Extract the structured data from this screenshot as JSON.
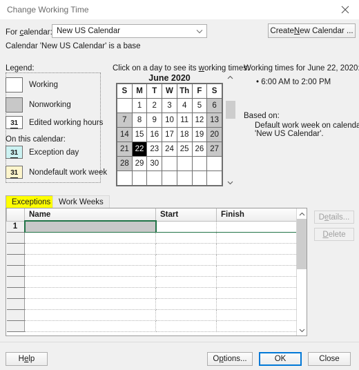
{
  "window": {
    "title": "Change Working Time",
    "close_icon": "close-icon"
  },
  "calendar_select": {
    "label": "For ",
    "label_accel": "c",
    "label_rest": "alendar:",
    "value": "New US Calendar",
    "arrow_icon": "chevron-down-icon",
    "create_label_pre": "Create ",
    "create_accel": "N",
    "create_label_post": "ew Calendar ...",
    "base_note": "Calendar 'New US Calendar' is a base"
  },
  "legend": {
    "label": "Legend:",
    "items": [
      {
        "name": "working",
        "text": "Working",
        "swatch": "plain",
        "color": "#ffffff",
        "glyph": ""
      },
      {
        "name": "nonworking",
        "text": "Nonworking",
        "swatch": "plain",
        "color": "#c8c8c8",
        "glyph": ""
      },
      {
        "name": "edited-working-hours",
        "text": "Edited working hours",
        "swatch": "day",
        "color": "#ffffff",
        "glyph": "31"
      }
    ],
    "subheading": "On this calendar:",
    "items2": [
      {
        "name": "exception-day",
        "text": "Exception day",
        "swatch": "day",
        "color": "#ccf2f2",
        "glyph": "31"
      },
      {
        "name": "nondefault-work-week",
        "text": "Nondefault work week",
        "swatch": "day",
        "color": "#fdf5cc",
        "glyph": "31"
      }
    ]
  },
  "calendar": {
    "hint_pre": "Click on a day to see its ",
    "hint_accel": "w",
    "hint_post": "orking times:",
    "month_title": "June 2020",
    "weekday_headers": [
      "S",
      "M",
      "T",
      "W",
      "Th",
      "F",
      "S"
    ],
    "weeks": [
      [
        {
          "d": "",
          "t": "empty"
        },
        {
          "d": "1",
          "t": "work"
        },
        {
          "d": "2",
          "t": "work"
        },
        {
          "d": "3",
          "t": "work"
        },
        {
          "d": "4",
          "t": "work"
        },
        {
          "d": "5",
          "t": "work"
        },
        {
          "d": "6",
          "t": "weekend"
        }
      ],
      [
        {
          "d": "7",
          "t": "weekend"
        },
        {
          "d": "8",
          "t": "work"
        },
        {
          "d": "9",
          "t": "work"
        },
        {
          "d": "10",
          "t": "work"
        },
        {
          "d": "11",
          "t": "work"
        },
        {
          "d": "12",
          "t": "work"
        },
        {
          "d": "13",
          "t": "weekend"
        }
      ],
      [
        {
          "d": "14",
          "t": "weekend"
        },
        {
          "d": "15",
          "t": "work"
        },
        {
          "d": "16",
          "t": "work"
        },
        {
          "d": "17",
          "t": "work"
        },
        {
          "d": "18",
          "t": "work"
        },
        {
          "d": "19",
          "t": "work"
        },
        {
          "d": "20",
          "t": "weekend"
        }
      ],
      [
        {
          "d": "21",
          "t": "weekend"
        },
        {
          "d": "22",
          "t": "selected"
        },
        {
          "d": "23",
          "t": "work"
        },
        {
          "d": "24",
          "t": "work"
        },
        {
          "d": "25",
          "t": "work"
        },
        {
          "d": "26",
          "t": "work"
        },
        {
          "d": "27",
          "t": "weekend"
        }
      ],
      [
        {
          "d": "28",
          "t": "weekend"
        },
        {
          "d": "29",
          "t": "work"
        },
        {
          "d": "30",
          "t": "work"
        },
        {
          "d": "",
          "t": "empty"
        },
        {
          "d": "",
          "t": "empty"
        },
        {
          "d": "",
          "t": "empty"
        },
        {
          "d": "",
          "t": "empty"
        }
      ],
      [
        {
          "d": "",
          "t": "empty"
        },
        {
          "d": "",
          "t": "empty"
        },
        {
          "d": "",
          "t": "empty"
        },
        {
          "d": "",
          "t": "empty"
        },
        {
          "d": "",
          "t": "empty"
        },
        {
          "d": "",
          "t": "empty"
        },
        {
          "d": "",
          "t": "empty"
        }
      ]
    ],
    "selected_day": "22",
    "scroll_up_icon": "chevron-up-icon",
    "scroll_down_icon": "chevron-down-icon"
  },
  "working_times": {
    "title": "Working times for June 22, 2020:",
    "entry": "• 6:00 AM to 2:00 PM",
    "based_on_label": "Based on:",
    "based_on_line1": "Default work week on calendar",
    "based_on_line2": "'New US Calendar'."
  },
  "tabs": [
    {
      "name": "exceptions",
      "label": "Exceptions",
      "active": true
    },
    {
      "name": "work-weeks",
      "label": "Work Weeks",
      "active": false
    }
  ],
  "exceptions_table": {
    "columns": [
      "",
      "Name",
      "Start",
      "Finish"
    ],
    "rows": [
      {
        "index": "1",
        "name": "",
        "start": "",
        "finish": "",
        "selected": true
      },
      {
        "index": "",
        "name": "",
        "start": "",
        "finish": "",
        "selected": false
      },
      {
        "index": "",
        "name": "",
        "start": "",
        "finish": "",
        "selected": false
      },
      {
        "index": "",
        "name": "",
        "start": "",
        "finish": "",
        "selected": false
      },
      {
        "index": "",
        "name": "",
        "start": "",
        "finish": "",
        "selected": false
      },
      {
        "index": "",
        "name": "",
        "start": "",
        "finish": "",
        "selected": false
      },
      {
        "index": "",
        "name": "",
        "start": "",
        "finish": "",
        "selected": false
      },
      {
        "index": "",
        "name": "",
        "start": "",
        "finish": "",
        "selected": false
      },
      {
        "index": "",
        "name": "",
        "start": "",
        "finish": "",
        "selected": false
      },
      {
        "index": "",
        "name": "",
        "start": "",
        "finish": "",
        "selected": false
      }
    ],
    "scroll_up_icon": "chevron-up-icon",
    "scroll_down_icon": "chevron-down-icon"
  },
  "side_buttons": {
    "details_pre": "D",
    "details_accel": "e",
    "details_post": "tails...",
    "details_enabled": false,
    "delete_pre": "",
    "delete_accel": "D",
    "delete_post": "elete",
    "delete_enabled": false
  },
  "footer": {
    "help_pre": "H",
    "help_accel": "e",
    "help_post": "lp",
    "options_pre": "O",
    "options_accel": "p",
    "options_post": "tions...",
    "ok": "OK",
    "close": "Close"
  }
}
